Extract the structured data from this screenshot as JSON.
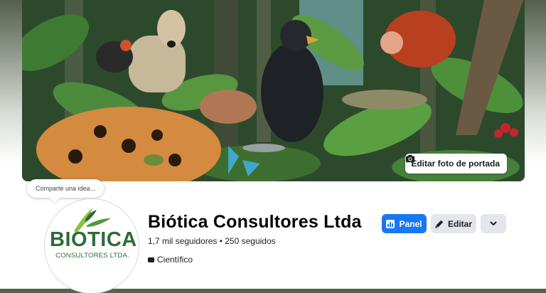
{
  "cover": {
    "edit_button_label": "Editar foto de portada",
    "edit_icon": "camera-icon"
  },
  "tooltip": {
    "text": "Comparte una idea..."
  },
  "profile": {
    "logo_word": "BIOTICA",
    "logo_subtitle": "CONSULTORES LTDA."
  },
  "page": {
    "name": "Biótica Consultores Ltda",
    "stats": "1,7 mil seguidores • 250 seguidos",
    "category": "Científico",
    "category_icon": "briefcase-icon"
  },
  "actions": {
    "panel_label": "Panel",
    "panel_icon": "dashboard-icon",
    "edit_label": "Editar",
    "edit_icon": "pencil-icon",
    "more_icon": "chevron-down-icon"
  },
  "colors": {
    "primary": "#1877f2",
    "secondary_button": "#e4e6eb",
    "logo_green": "#2f6b3a"
  }
}
